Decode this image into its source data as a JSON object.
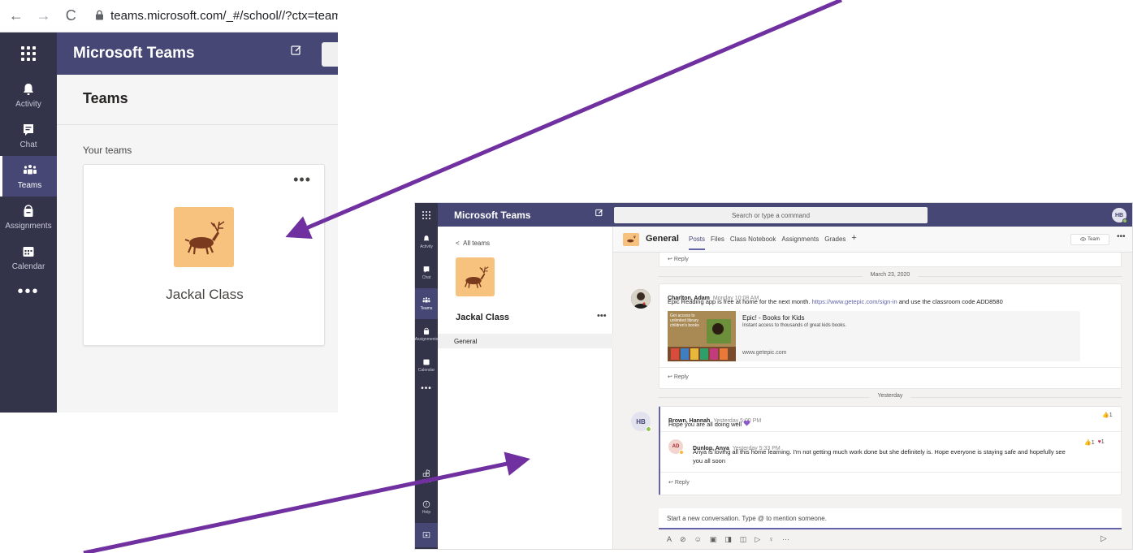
{
  "colors": {
    "teams_purple": "#464775",
    "rail_dark": "#33344a",
    "accent": "#6264a7",
    "arrow": "#7030a0",
    "avatar_orange": "#f7c17e"
  },
  "browser": {
    "back_icon": "arrow-left-icon",
    "forward_icon": "arrow-right-icon",
    "reload_icon": "reload-icon",
    "url": "teams.microsoft.com/_#/school//?ctx=team"
  },
  "shot1": {
    "app_title": "Microsoft Teams",
    "rail": [
      {
        "label": "Activity",
        "icon": "bell-icon"
      },
      {
        "label": "Chat",
        "icon": "chat-icon"
      },
      {
        "label": "Teams",
        "icon": "teams-icon",
        "active": true
      },
      {
        "label": "Assignments",
        "icon": "assignments-icon"
      },
      {
        "label": "Calendar",
        "icon": "calendar-icon"
      }
    ],
    "more_label": "•••",
    "page_title": "Teams",
    "section_label": "Your teams",
    "card": {
      "more": "•••",
      "team_name": "Jackal Class"
    }
  },
  "shot2": {
    "app_title": "Microsoft Teams",
    "search_placeholder": "Search or type a command",
    "me_initials": "HB",
    "rail": [
      {
        "label": "Activity",
        "icon": "bell-icon"
      },
      {
        "label": "Chat",
        "icon": "chat-icon"
      },
      {
        "label": "Teams",
        "icon": "teams-icon",
        "active": true
      },
      {
        "label": "Assignments",
        "icon": "assignments-icon"
      },
      {
        "label": "Calendar",
        "icon": "calendar-icon"
      }
    ],
    "more_label": "•••",
    "rail_bottom": [
      {
        "label": "Apps",
        "icon": "apps-icon"
      },
      {
        "label": "Help",
        "icon": "help-icon"
      }
    ],
    "all_teams": "All teams",
    "team_name": "Jackal Class",
    "team_more": "•••",
    "channel": "General",
    "channel_head": {
      "name": "General",
      "tabs": [
        "Posts",
        "Files",
        "Class Notebook",
        "Assignments",
        "Grades"
      ],
      "add_tab": "+",
      "team_button": "Team",
      "more": "•••"
    },
    "feed": {
      "top_reply": "Reply",
      "date1": "March 23, 2020",
      "post1": {
        "author": "Charlton, Adam",
        "time": "Monday 10:08 AM",
        "text_before": "Epic Reading app is free at home for the next month.",
        "link": "https://www.getepic.com/sign-in",
        "text_after": "and use the classroom code ADD8580",
        "preview_title": "Epic! - Books for Kids",
        "preview_desc": "Instant access to thousands of great kids books.",
        "preview_url": "www.getepic.com",
        "preview_img_text": "Get access to unlimited library children's books",
        "reply": "Reply"
      },
      "date2": "Yesterday",
      "post2": {
        "author": "Brown, Hannah",
        "time": "Yesterday 5:00 PM",
        "initials": "HB",
        "text": "Hope you are all doing well",
        "reaction_like": "1",
        "reply_author": "Dunlop, Anya",
        "reply_time": "Yesterday 5:33 PM",
        "reply_initials": "AD",
        "reply_text": "Anya is loving all this home learning. I'm not getting much work done but she definitely is. Hope everyone is staying safe and hopefully see you all soon",
        "reply_like": "1",
        "reply_heart": "1",
        "reply": "Reply"
      }
    },
    "compose_placeholder": "Start a new conversation. Type @ to mention someone.",
    "toolbar_icons": [
      "format-icon",
      "attach-icon",
      "emoji-icon",
      "gif-icon",
      "sticker-icon",
      "meet-icon",
      "stream-icon",
      "praise-icon",
      "more-icon"
    ],
    "toolbar_more": "···"
  }
}
